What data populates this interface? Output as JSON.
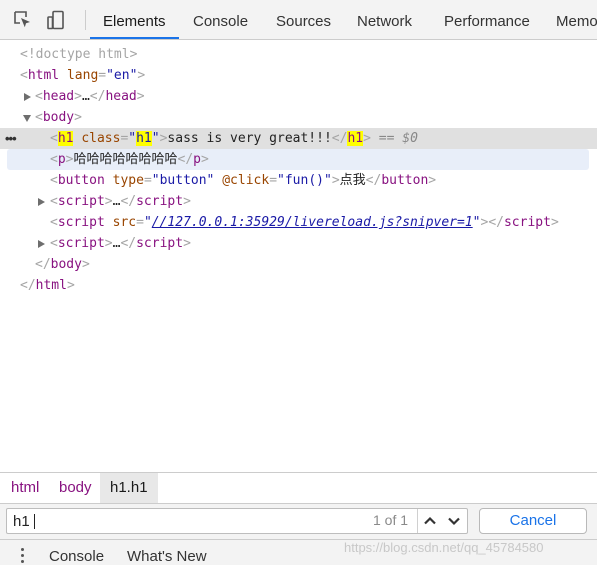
{
  "toolbar": {
    "icons": [
      "inspect-element-icon",
      "device-toolbar-icon"
    ],
    "tabs": [
      {
        "label": "Elements",
        "active": true
      },
      {
        "label": "Console",
        "active": false
      },
      {
        "label": "Sources",
        "active": false
      },
      {
        "label": "Network",
        "active": false
      },
      {
        "label": "Performance",
        "active": false
      },
      {
        "label": "Memo",
        "active": false
      }
    ]
  },
  "tree": {
    "doctype": "<!doctype html>",
    "html_tag": "html",
    "html_attr_name": "lang",
    "html_attr_value": "\"en\"",
    "head_tag": "head",
    "body_tag": "body",
    "ellipsis": "…",
    "h1_tag": "h1",
    "h1_attr_name": "class",
    "h1_attr_value": "h1",
    "h1_text": "sass is very great!!!",
    "selected_marker": "== $0",
    "p_tag": "p",
    "p_text": "哈哈哈哈哈哈哈哈",
    "button_tag": "button",
    "button_attr1_name": "type",
    "button_attr1_value": "\"button\"",
    "button_attr2_name": "@click",
    "button_attr2_value": "\"fun()\"",
    "button_text": "点我",
    "script_tag": "script",
    "script_attr_name": "src",
    "script_src": "//127.0.0.1:35929/livereload.js?snipver=1",
    "gutter_dots": "•••"
  },
  "breadcrumb": {
    "items": [
      {
        "label": "html",
        "active": false
      },
      {
        "label": "body",
        "active": false
      },
      {
        "label": "h1.h1",
        "active": true
      }
    ]
  },
  "search": {
    "value": "h1",
    "match_count": "1 of 1",
    "cancel_label": "Cancel"
  },
  "drawer": {
    "tabs": [
      "Console",
      "What's New"
    ],
    "watermark": "https://blog.csdn.net/qq_45784580"
  },
  "colors": {
    "active_tab_underline": "#1a73e8",
    "tag": "#881280",
    "attr_name": "#994500",
    "attr_value": "#1a1aa6",
    "highlight": "#ffff00"
  }
}
